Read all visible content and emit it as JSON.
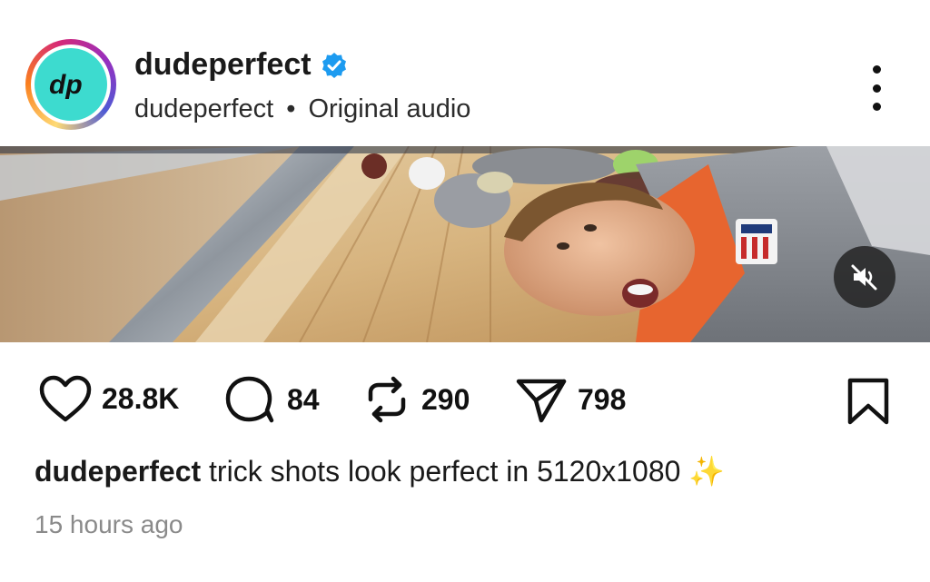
{
  "post": {
    "username": "dudeperfect",
    "verified": true,
    "avatar_text": "dp",
    "audio_user": "dudeperfect",
    "audio_separator": "•",
    "audio_label": "Original audio",
    "more_icon": "more-vertical-icon"
  },
  "media": {
    "muted": true,
    "mute_icon": "speaker-muted-icon"
  },
  "actions": {
    "likes": "28.8K",
    "comments": "84",
    "reposts": "290",
    "shares": "798",
    "icons": [
      "heart-icon",
      "comment-icon",
      "repost-icon",
      "share-icon",
      "bookmark-icon"
    ]
  },
  "caption": {
    "username": "dudeperfect",
    "text": "trick shots look perfect in 5120x1080",
    "emoji": "✨"
  },
  "timestamp": "15 hours ago",
  "colors": {
    "verified_blue": "#1d9bf0",
    "avatar_bg": "#3ddbcf",
    "text_primary": "#111111",
    "text_muted": "#8a8a8a"
  }
}
